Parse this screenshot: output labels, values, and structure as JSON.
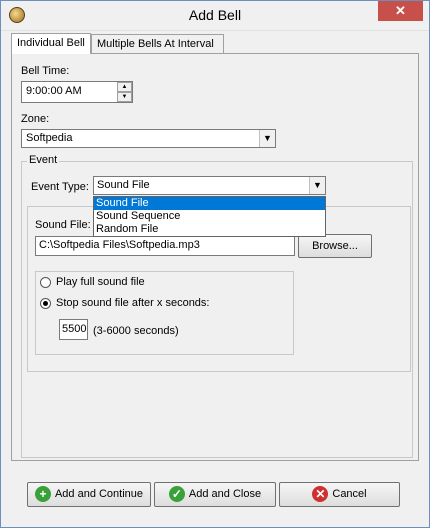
{
  "window": {
    "title": "Add Bell",
    "close_glyph": "✕"
  },
  "tabs": [
    {
      "label": "Individual Bell"
    },
    {
      "label": "Multiple Bells At Interval"
    }
  ],
  "bell_time": {
    "label": "Bell Time:",
    "value": "9:00:00 AM"
  },
  "zone": {
    "label": "Zone:",
    "value": "Softpedia"
  },
  "event": {
    "group_label": "Event",
    "type_label": "Event Type:",
    "type_value": "Sound File",
    "options": [
      "Sound File",
      "Sound Sequence",
      "Random File"
    ],
    "selected_option": "Sound File"
  },
  "sound": {
    "label": "Sound File:",
    "path": "C:\\Softpedia Files\\Softpedia.mp3",
    "browse_label": "Browse...",
    "play_full_label": "Play full sound file",
    "stop_after_label": "Stop sound file after x seconds:",
    "seconds_value": "5500",
    "seconds_range": "(3-6000 seconds)"
  },
  "footer": {
    "add_continue": "Add and Continue",
    "add_close": "Add and Close",
    "cancel": "Cancel"
  },
  "icons": {
    "app": "bell-icon",
    "add": "plus-icon",
    "check": "check-icon",
    "cancel": "x-icon"
  },
  "colors": {
    "close_button": "#c7504b",
    "selection": "#0078d7",
    "add_icon": "#3aa13a",
    "cancel_icon": "#d03030"
  }
}
